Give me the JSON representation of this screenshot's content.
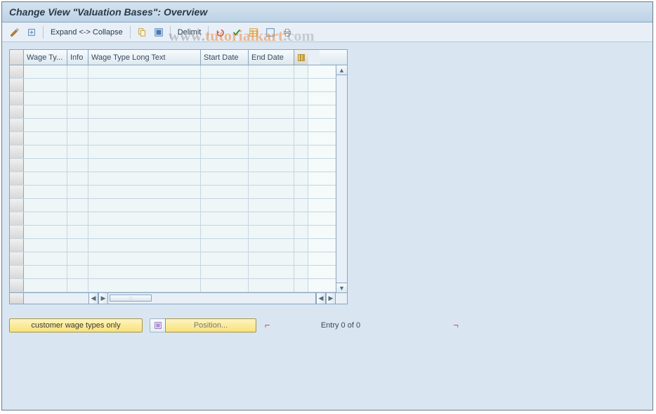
{
  "title": "Change View \"Valuation Bases\": Overview",
  "toolbar": {
    "expand_collapse_label": "Expand <-> Collapse",
    "delimit_label": "Delimit"
  },
  "table": {
    "columns": {
      "wage_type": "Wage Ty...",
      "info": "Info",
      "long_text": "Wage Type Long Text",
      "start_date": "Start Date",
      "end_date": "End Date"
    },
    "row_count": 17
  },
  "footer": {
    "customer_btn": "customer wage types only",
    "position_btn": "Position...",
    "entry_text": "Entry 0 of 0"
  },
  "watermark": {
    "part1": "www.",
    "part2": "tutorialkart",
    "part3": ".com"
  }
}
